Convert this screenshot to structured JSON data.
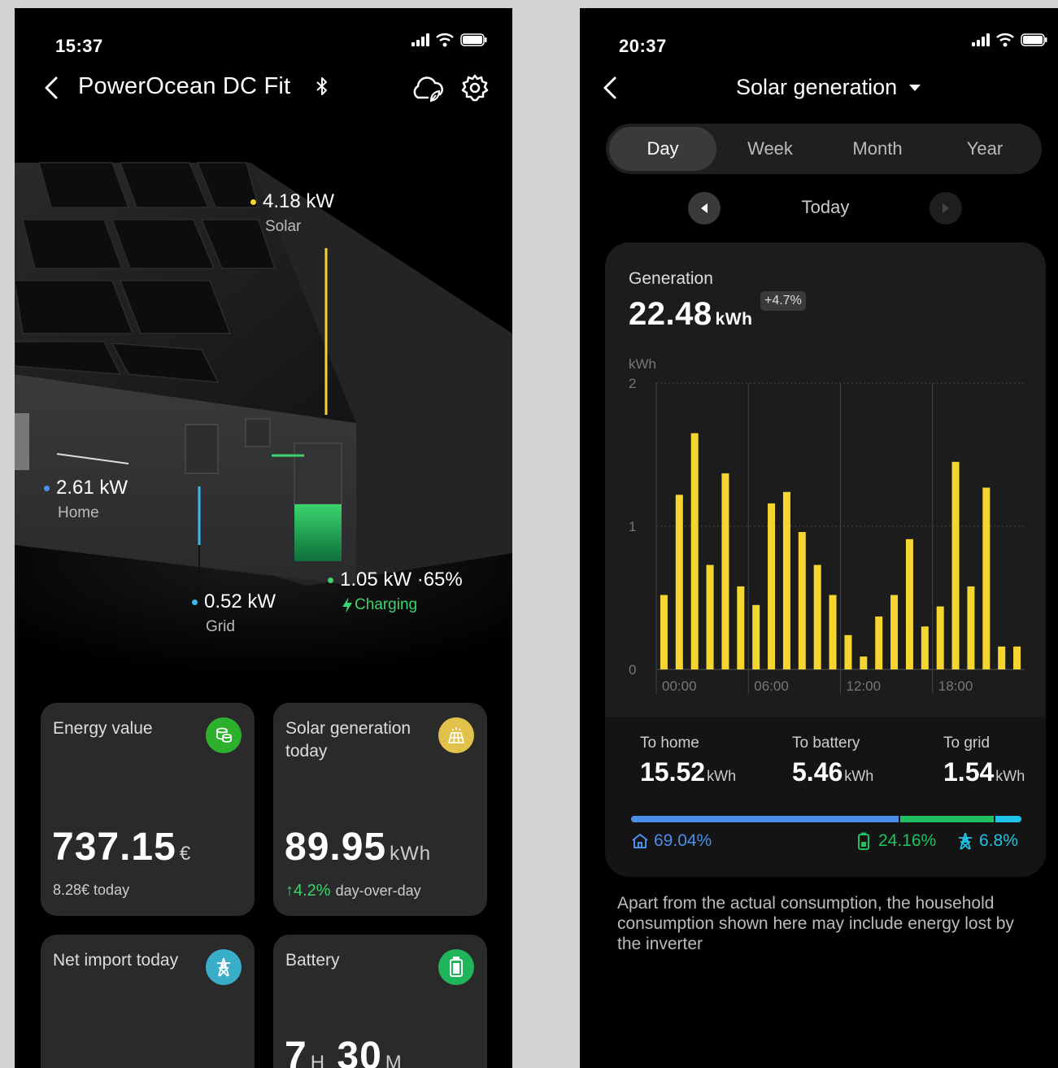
{
  "left": {
    "status": {
      "time": "15:37"
    },
    "header": {
      "title": "PowerOcean DC Fit"
    },
    "colors": {
      "solar": "#f5d631",
      "home": "#4a8fe8",
      "grid": "#3ab9e8",
      "battery": "#3bd46d",
      "charging": "#3bd46d"
    },
    "flows": {
      "solar": {
        "value": "4.18 kW",
        "label": "Solar"
      },
      "home": {
        "value": "2.61 kW",
        "label": "Home"
      },
      "grid": {
        "value": "0.52 kW",
        "label": "Grid"
      },
      "battery": {
        "value": "1.05 kW ·65%",
        "label": "Charging"
      }
    },
    "cards": {
      "energy": {
        "title": "Energy value",
        "value": "737.15",
        "unit": "€",
        "sub": "8.28€ today",
        "icon": "coin-stack-icon"
      },
      "solar": {
        "title": "Solar generation today",
        "value": "89.95",
        "unit": "kWh",
        "change": "4.2%",
        "change_suffix": "day-over-day",
        "icon": "solar-panel-icon"
      },
      "net_import": {
        "title": "Net import today",
        "icon": "grid-tower-icon"
      },
      "battery": {
        "title": "Battery",
        "hours": "7",
        "hours_unit": "H",
        "minutes": "30",
        "minutes_unit": "M",
        "icon": "battery-icon"
      }
    }
  },
  "right": {
    "status": {
      "time": "20:37"
    },
    "header": {
      "title": "Solar generation"
    },
    "tabs": [
      {
        "label": "Day",
        "active": true
      },
      {
        "label": "Week",
        "active": false
      },
      {
        "label": "Month",
        "active": false
      },
      {
        "label": "Year",
        "active": false
      }
    ],
    "date_label": "Today",
    "generation": {
      "label": "Generation",
      "value": "22.48",
      "unit": "kWh",
      "change": "+4.7%"
    },
    "split": {
      "home": {
        "title": "To home",
        "value": "15.52",
        "unit": "kWh",
        "pct": "69.04%"
      },
      "battery": {
        "title": "To battery",
        "value": "5.46",
        "unit": "kWh",
        "pct": "24.16%"
      },
      "grid": {
        "title": "To grid",
        "value": "1.54",
        "unit": "kWh",
        "pct": "6.8%"
      }
    },
    "note": "Apart from the actual consumption, the household consumption shown here may include energy lost by the inverter"
  },
  "chart_data": {
    "type": "bar",
    "ylabel": "kWh",
    "ylim": [
      0,
      2
    ],
    "yticks": [
      "0",
      "1",
      "2"
    ],
    "xticks": [
      "00:00",
      "06:00",
      "12:00",
      "18:00"
    ],
    "color": "#f5d631",
    "grid": true,
    "values": [
      0.52,
      1.22,
      1.65,
      0.73,
      1.37,
      0.58,
      0.45,
      1.16,
      1.24,
      0.96,
      0.73,
      0.52,
      0.24,
      0.09,
      0.37,
      0.52,
      0.91,
      0.3,
      0.44,
      1.45,
      0.58,
      1.27,
      0.16,
      0.16
    ]
  }
}
